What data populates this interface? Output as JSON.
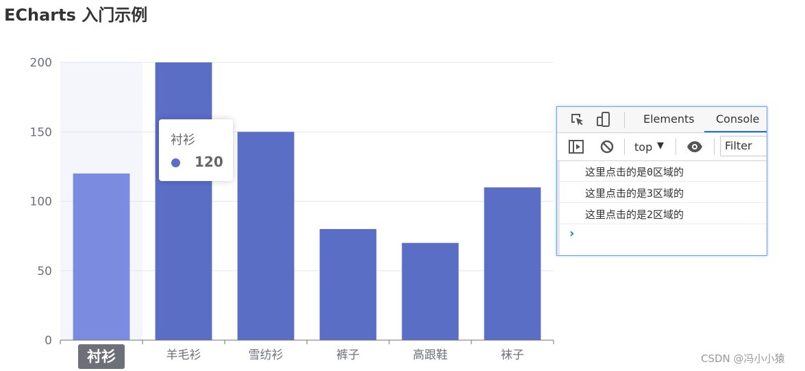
{
  "page": {
    "title": "ECharts 入门示例"
  },
  "chart_data": {
    "type": "bar",
    "title": "",
    "xlabel": "",
    "ylabel": "",
    "categories": [
      "衬衫",
      "羊毛衫",
      "雪纺衫",
      "裤子",
      "高跟鞋",
      "袜子"
    ],
    "series": [
      {
        "values": [
          120,
          200,
          150,
          80,
          70,
          110
        ]
      }
    ],
    "ylim": [
      0,
      200
    ],
    "yticks": [
      0,
      50,
      100,
      150,
      200
    ],
    "grid": true,
    "bar_color": "#5b6ec6",
    "highlight_color": "#7a8be0",
    "highlighted_category": "衬衫",
    "axis_pointer_label": "衬衫"
  },
  "tooltip": {
    "name": "衬衫",
    "value": "120",
    "marker_color": "#5b6ec6"
  },
  "devtools": {
    "tabs": [
      {
        "label": "Elements",
        "active": false
      },
      {
        "label": "Console",
        "active": true
      }
    ],
    "context": "top",
    "filter_placeholder": "Filter",
    "logs": [
      "这里点击的是0区域的",
      "这里点击的是3区域的",
      "这里点击的是2区域的"
    ],
    "icons": [
      "inspect-element-icon",
      "device-toolbar-icon",
      "sidebar-toggle-icon",
      "clear-console-icon",
      "dropdown-arrow-icon",
      "live-expression-eye-icon",
      "prompt-chevron-icon"
    ],
    "accent_color": "#1a73e8"
  },
  "watermark": "CSDN @冯小小猿"
}
